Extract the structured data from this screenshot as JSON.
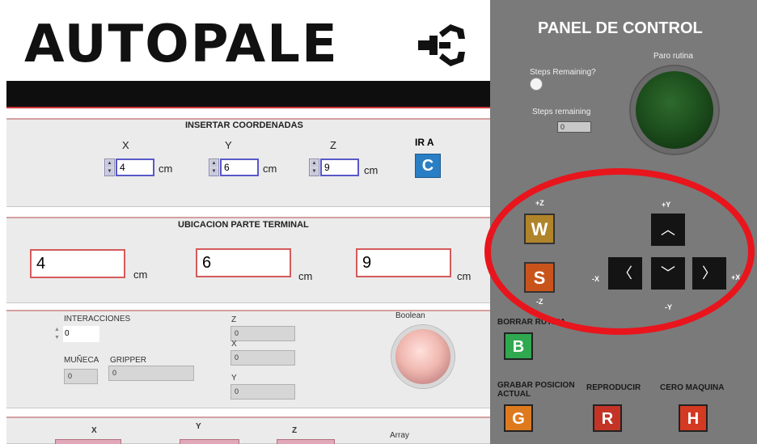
{
  "header": {
    "logo_text": "AUTOPALE"
  },
  "coords_section": {
    "title": "INSERTAR COORDENADAS",
    "x_label": "X",
    "y_label": "Y",
    "z_label": "Z",
    "x_value": "4",
    "y_value": "6",
    "z_value": "9",
    "unit": "cm",
    "go_label": "IR A",
    "go_button": "C"
  },
  "ubicacion_section": {
    "title": "UBICACION PARTE TERMINAL",
    "x_value": "4",
    "y_value": "6",
    "z_value": "9",
    "unit": "cm"
  },
  "info_section": {
    "interacciones_label": "INTERACCIONES",
    "interacciones_value": "0",
    "muneca_label": "MUÑECA",
    "muneca_value": "0",
    "gripper_label": "GRIPPER",
    "gripper_value": "0",
    "z_label": "Z",
    "z_value": "0",
    "x_label": "X",
    "x_value": "0",
    "y_label": "Y",
    "y_value": "0",
    "boolean_label": "Boolean"
  },
  "bottom_section": {
    "x_label": "X",
    "y_label": "Y",
    "z_label": "Z",
    "array_label": "Array"
  },
  "control_panel": {
    "title": "PANEL DE CONTROL",
    "steps_remaining_q": "Steps Remaining?",
    "steps_remaining_label": "Steps remaining",
    "steps_remaining_value": "0",
    "paro_label": "Paro rutina",
    "plus_z": "+Z",
    "minus_z": "-Z",
    "plus_y": "+Y",
    "minus_y": "-Y",
    "plus_x": "+X",
    "minus_x": "-X",
    "w_key": "W",
    "s_key": "S",
    "arrow_up": "︿",
    "arrow_down": "﹀",
    "arrow_left": "〈",
    "arrow_right": "〉",
    "borrar_label": "BORRAR RUTINA",
    "b_key": "B",
    "grabar_label_1": "GRABAR POSICION",
    "grabar_label_2": "ACTUAL",
    "g_key": "G",
    "reproducir_label": "REPRODUCIR",
    "r_key": "R",
    "cero_label": "CERO MAQUINA",
    "h_key": "H"
  },
  "colors": {
    "panel_bg": "#7a7a7a",
    "highlight_ellipse": "#e8151d",
    "ir_a_button": "#2a7fc4"
  }
}
